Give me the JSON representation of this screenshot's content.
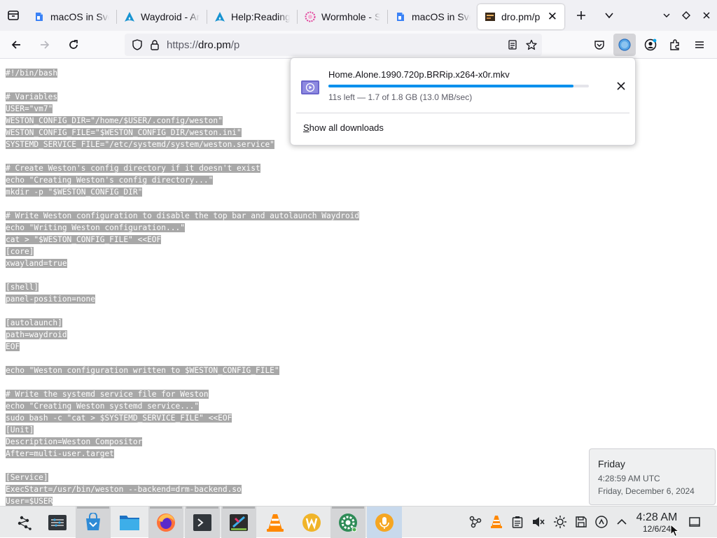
{
  "tabs": [
    {
      "title": "macOS in Svelte",
      "favicon": "svelte-blue-favicon",
      "active": false
    },
    {
      "title": "Waydroid - ArchWiki",
      "favicon": "archlinux-favicon",
      "active": false
    },
    {
      "title": "Help:Reading",
      "favicon": "archlinux-favicon",
      "active": false
    },
    {
      "title": "Wormhole - Share files",
      "favicon": "wormhole-favicon",
      "active": false
    },
    {
      "title": "macOS in Svelte",
      "favicon": "svelte-blue-favicon",
      "active": false
    },
    {
      "title": "dro.pm/p",
      "favicon": "dropm-favicon",
      "active": true
    }
  ],
  "url": {
    "prefix": "https://",
    "host": "dro.pm",
    "path": "/p"
  },
  "code_lines": [
    "#!/bin/bash",
    "",
    "# Variables",
    "USER=\"vm7\"",
    "WESTON_CONFIG_DIR=\"/home/$USER/.config/weston\"",
    "WESTON_CONFIG_FILE=\"$WESTON_CONFIG_DIR/weston.ini\"",
    "SYSTEMD_SERVICE_FILE=\"/etc/systemd/system/weston.service\"",
    "",
    "# Create Weston's config directory if it doesn't exist",
    "echo \"Creating Weston's config directory...\"",
    "mkdir -p \"$WESTON_CONFIG_DIR\"",
    "",
    "# Write Weston configuration to disable the top bar and autolaunch Waydroid",
    "echo \"Writing Weston configuration...\"",
    "cat > \"$WESTON_CONFIG_FILE\" <<EOF",
    "[core]",
    "xwayland=true",
    "",
    "[shell]",
    "panel-position=none",
    "",
    "[autolaunch]",
    "path=waydroid",
    "EOF",
    "",
    "echo \"Weston configuration written to $WESTON_CONFIG_FILE\"",
    "",
    "# Write the systemd service file for Weston",
    "echo \"Creating Weston systemd service...\"",
    "sudo bash -c \"cat > $SYSTEMD_SERVICE_FILE\" <<EOF",
    "[Unit]",
    "Description=Weston Compositor",
    "After=multi-user.target",
    "",
    "[Service]",
    "ExecStart=/usr/bin/weston --backend=drm-backend.so",
    "User=$USER"
  ],
  "download": {
    "filename": "Home.Alone.1990.720p.BRRip.x264-x0r.mkv",
    "status": "11s left — 1.7 of 1.8 GB (13.0 MB/sec)",
    "progress_percent": 94,
    "show_all_label": "Show all downloads"
  },
  "clock_popup": {
    "day": "Friday",
    "utc_time": "4:28:59 AM UTC",
    "full_date": "Friday, December 6, 2024"
  },
  "taskbar": {
    "time": "4:28 AM",
    "date": "12/6/24",
    "apps": [
      "application-launcher-icon",
      "system-settings-icon",
      "discover-icon",
      "file-manager-icon",
      "firefox-icon",
      "terminal-icon",
      "kdenlive-icon",
      "vlc-icon",
      "wps-office-icon",
      "settings-gear-icon",
      "voice-recorder-icon"
    ],
    "tray": [
      "network-icon",
      "vlc-tray-icon",
      "clipboard-icon",
      "volume-muted-icon",
      "brightness-icon",
      "save-icon",
      "updates-icon",
      "expand-tray-icon",
      "show-desktop-icon"
    ]
  },
  "colors": {
    "accent": "#0090ed",
    "selection": "#a8a8a8",
    "focused_task": "#3daee9"
  }
}
